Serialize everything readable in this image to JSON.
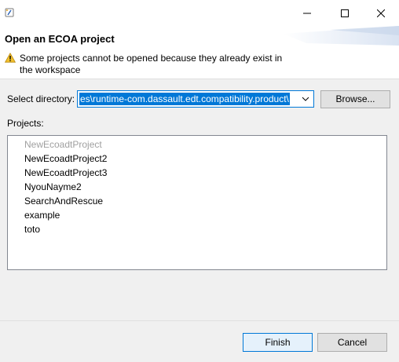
{
  "window": {
    "icon": "eclipse-edt-icon",
    "controls": [
      "minimize-icon",
      "maximize-icon",
      "close-icon"
    ]
  },
  "header": {
    "title": "Open an ECOA project",
    "warning_icon": "warning-icon",
    "warning_line1": "Some projects cannot be opened because they already exist in",
    "warning_line2": "the workspace"
  },
  "directory": {
    "label": "Select directory:",
    "value": "es\\runtime-com.dassault.edt.compatibility.product\\",
    "browse_label": "Browse..."
  },
  "projects": {
    "label": "Projects:",
    "items": [
      {
        "name": "NewEcoadtProject",
        "enabled": false
      },
      {
        "name": "NewEcoadtProject2",
        "enabled": true
      },
      {
        "name": "NewEcoadtProject3",
        "enabled": true
      },
      {
        "name": "NyouNayme2",
        "enabled": true
      },
      {
        "name": "SearchAndRescue",
        "enabled": true
      },
      {
        "name": "example",
        "enabled": true
      },
      {
        "name": "toto",
        "enabled": true
      }
    ]
  },
  "footer": {
    "finish_label": "Finish",
    "cancel_label": "Cancel"
  },
  "colors": {
    "accent": "#0078d7",
    "disabled_text": "#a0a0a0",
    "warning": "#f2c12e"
  }
}
